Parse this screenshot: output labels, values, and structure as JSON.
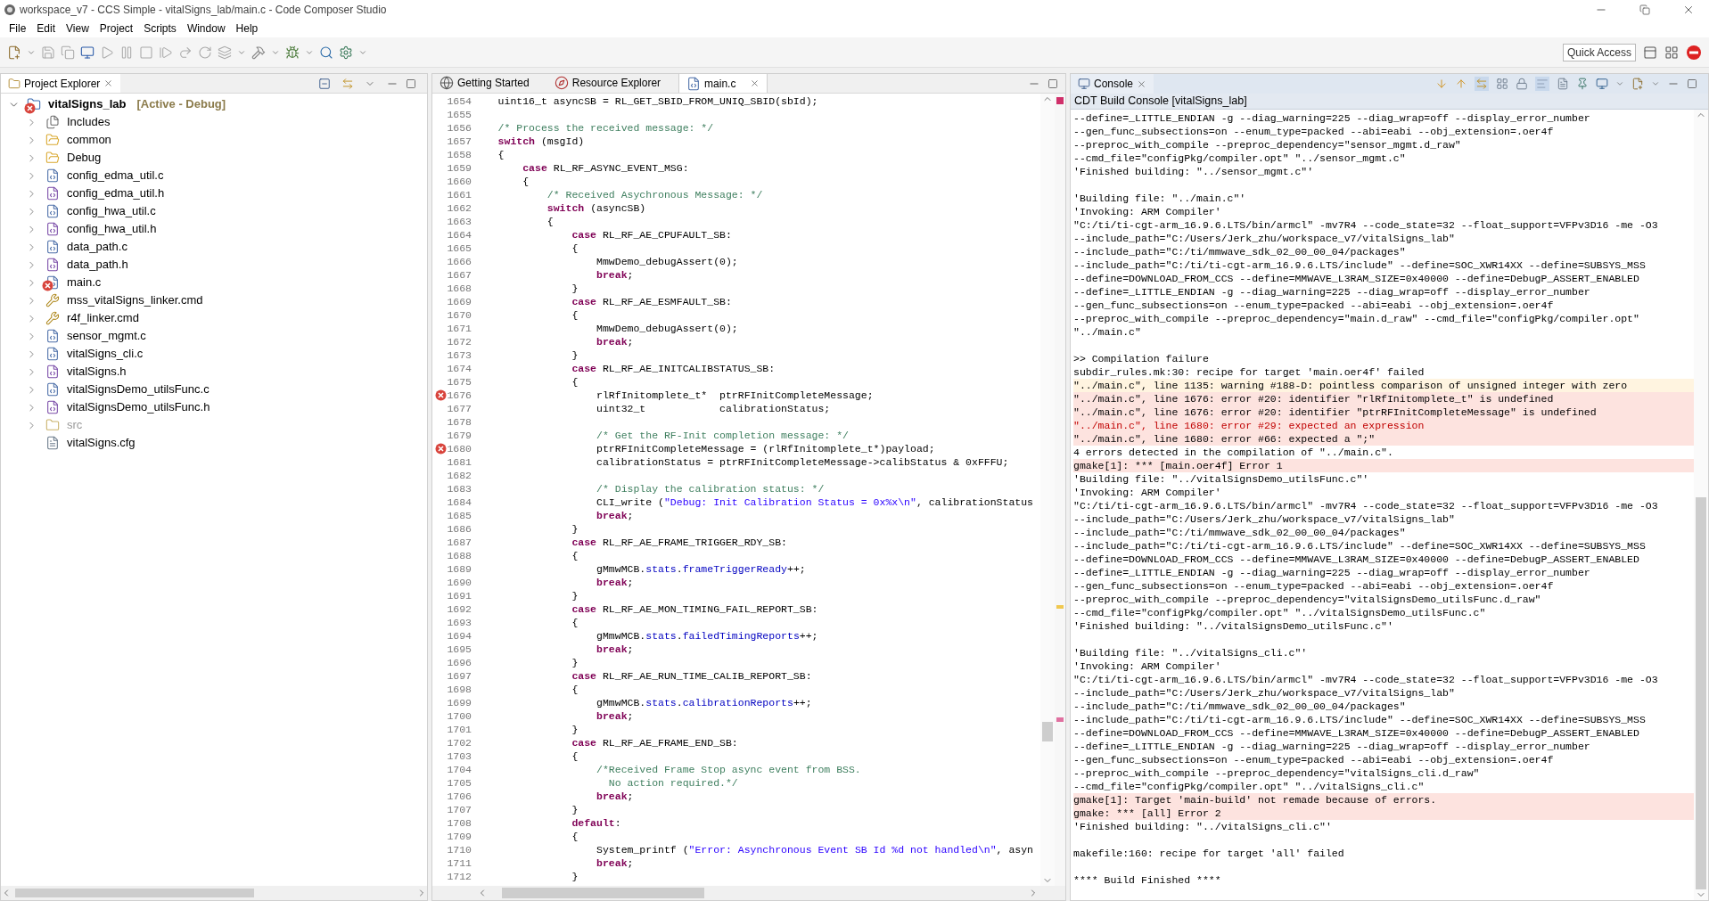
{
  "window": {
    "title": "workspace_v7 - CCS Simple - vitalSigns_lab/main.c - Code Composer Studio"
  },
  "menu": [
    "File",
    "Edit",
    "View",
    "Project",
    "Scripts",
    "Window",
    "Help"
  ],
  "quick_access": "Quick Access",
  "project_explorer": {
    "title": "Project Explorer",
    "root": {
      "name": "vitalSigns_lab",
      "annotation": "[Active - Debug]",
      "expanded": true,
      "error": true,
      "children": [
        {
          "name": "Includes",
          "kind": "includes",
          "expandable": true,
          "error": false,
          "greyed": false
        },
        {
          "name": "common",
          "kind": "folder",
          "expandable": true,
          "error": false,
          "greyed": false
        },
        {
          "name": "Debug",
          "kind": "folder",
          "expandable": true,
          "error": false,
          "greyed": false
        },
        {
          "name": "config_edma_util.c",
          "kind": "c-file",
          "expandable": true,
          "error": false,
          "greyed": false
        },
        {
          "name": "config_edma_util.h",
          "kind": "h-file",
          "expandable": true,
          "error": false,
          "greyed": false
        },
        {
          "name": "config_hwa_util.c",
          "kind": "c-file",
          "expandable": true,
          "error": false,
          "greyed": false
        },
        {
          "name": "config_hwa_util.h",
          "kind": "h-file",
          "expandable": true,
          "error": false,
          "greyed": false
        },
        {
          "name": "data_path.c",
          "kind": "c-file",
          "expandable": true,
          "error": false,
          "greyed": false
        },
        {
          "name": "data_path.h",
          "kind": "h-file",
          "expandable": true,
          "error": false,
          "greyed": false
        },
        {
          "name": "main.c",
          "kind": "c-file",
          "expandable": true,
          "error": true,
          "greyed": false
        },
        {
          "name": "mss_vitalSigns_linker.cmd",
          "kind": "linker",
          "expandable": true,
          "error": false,
          "greyed": false
        },
        {
          "name": "r4f_linker.cmd",
          "kind": "linker",
          "expandable": true,
          "error": false,
          "greyed": false
        },
        {
          "name": "sensor_mgmt.c",
          "kind": "c-file",
          "expandable": true,
          "error": false,
          "greyed": false
        },
        {
          "name": "vitalSigns_cli.c",
          "kind": "c-file",
          "expandable": true,
          "error": false,
          "greyed": false
        },
        {
          "name": "vitalSigns.h",
          "kind": "h-file",
          "expandable": true,
          "error": false,
          "greyed": false
        },
        {
          "name": "vitalSignsDemo_utilsFunc.c",
          "kind": "c-file",
          "expandable": true,
          "error": false,
          "greyed": false
        },
        {
          "name": "vitalSignsDemo_utilsFunc.h",
          "kind": "h-file",
          "expandable": true,
          "error": false,
          "greyed": false
        },
        {
          "name": "src",
          "kind": "source-folder",
          "expandable": true,
          "error": false,
          "greyed": true
        },
        {
          "name": "vitalSigns.cfg",
          "kind": "config",
          "expandable": false,
          "error": false,
          "greyed": false
        }
      ]
    }
  },
  "editor": {
    "tabs": [
      {
        "label": "Getting Started",
        "kind": "globe",
        "selected": false,
        "closable": false
      },
      {
        "label": "Resource Explorer",
        "kind": "compass",
        "selected": false,
        "closable": false
      },
      {
        "label": "main.c",
        "kind": "c-file",
        "selected": true,
        "closable": true
      }
    ],
    "lines": [
      {
        "number": "1654",
        "error": false,
        "segments": [
          {
            "kind": "plain",
            "text": "    uint16_t asyncSB = RL_GET_SBID_FROM_UNIQ_SBID(sbId);"
          }
        ]
      },
      {
        "number": "1655",
        "error": false
      },
      {
        "number": "1656",
        "error": false,
        "segments": [
          {
            "kind": "comment",
            "text": "    /* Process the received message: */"
          }
        ]
      },
      {
        "number": "1657",
        "error": false,
        "segments": [
          {
            "kind": "keyword",
            "text": "    switch"
          },
          {
            "kind": "plain",
            "text": " (msgId)"
          }
        ]
      },
      {
        "number": "1658",
        "error": false,
        "segments": [
          {
            "kind": "plain",
            "text": "    {"
          }
        ]
      },
      {
        "number": "1659",
        "error": false,
        "segments": [
          {
            "kind": "keyword",
            "text": "        case"
          },
          {
            "kind": "plain",
            "text": " RL_RF_ASYNC_EVENT_MSG:"
          }
        ]
      },
      {
        "number": "1660",
        "error": false,
        "segments": [
          {
            "kind": "plain",
            "text": "        {"
          }
        ]
      },
      {
        "number": "1661",
        "error": false,
        "segments": [
          {
            "kind": "comment",
            "text": "            /* Received Asychronous Message: */"
          }
        ]
      },
      {
        "number": "1662",
        "error": false,
        "segments": [
          {
            "kind": "keyword",
            "text": "            switch"
          },
          {
            "kind": "plain",
            "text": " (asyncSB)"
          }
        ]
      },
      {
        "number": "1663",
        "error": false,
        "segments": [
          {
            "kind": "plain",
            "text": "            {"
          }
        ]
      },
      {
        "number": "1664",
        "error": false,
        "segments": [
          {
            "kind": "keyword",
            "text": "                case"
          },
          {
            "kind": "plain",
            "text": " RL_RF_AE_CPUFAULT_SB:"
          }
        ]
      },
      {
        "number": "1665",
        "error": false,
        "segments": [
          {
            "kind": "plain",
            "text": "                {"
          }
        ]
      },
      {
        "number": "1666",
        "error": false,
        "segments": [
          {
            "kind": "plain",
            "text": "                    MmwDemo_debugAssert(0);"
          }
        ]
      },
      {
        "number": "1667",
        "error": false,
        "segments": [
          {
            "kind": "keyword",
            "text": "                    break"
          },
          {
            "kind": "plain",
            "text": ";"
          }
        ]
      },
      {
        "number": "1668",
        "error": false,
        "segments": [
          {
            "kind": "plain",
            "text": "                }"
          }
        ]
      },
      {
        "number": "1669",
        "error": false,
        "segments": [
          {
            "kind": "keyword",
            "text": "                case"
          },
          {
            "kind": "plain",
            "text": " RL_RF_AE_ESMFAULT_SB:"
          }
        ]
      },
      {
        "number": "1670",
        "error": false,
        "segments": [
          {
            "kind": "plain",
            "text": "                {"
          }
        ]
      },
      {
        "number": "1671",
        "error": false,
        "segments": [
          {
            "kind": "plain",
            "text": "                    MmwDemo_debugAssert(0);"
          }
        ]
      },
      {
        "number": "1672",
        "error": false,
        "segments": [
          {
            "kind": "keyword",
            "text": "                    break"
          },
          {
            "kind": "plain",
            "text": ";"
          }
        ]
      },
      {
        "number": "1673",
        "error": false,
        "segments": [
          {
            "kind": "plain",
            "text": "                }"
          }
        ]
      },
      {
        "number": "1674",
        "error": false,
        "segments": [
          {
            "kind": "keyword",
            "text": "                case"
          },
          {
            "kind": "plain",
            "text": " RL_RF_AE_INITCALIBSTATUS_SB:"
          }
        ]
      },
      {
        "number": "1675",
        "error": false,
        "segments": [
          {
            "kind": "plain",
            "text": "                {"
          }
        ]
      },
      {
        "number": "1676",
        "error": true,
        "segments": [
          {
            "kind": "plain",
            "text": "                    rlRfInitomplete_t*  ptrRFInitCompleteMessage;"
          }
        ]
      },
      {
        "number": "1677",
        "error": false,
        "segments": [
          {
            "kind": "plain",
            "text": "                    uint32_t            calibrationStatus;"
          }
        ]
      },
      {
        "number": "1678",
        "error": false
      },
      {
        "number": "1679",
        "error": false,
        "segments": [
          {
            "kind": "comment",
            "text": "                    /* Get the RF-Init completion message: */"
          }
        ]
      },
      {
        "number": "1680",
        "error": true,
        "segments": [
          {
            "kind": "plain",
            "text": "                    ptrRFInitCompleteMessage = (rlRfInitomplete_t*)payload;"
          }
        ]
      },
      {
        "number": "1681",
        "error": false,
        "segments": [
          {
            "kind": "plain",
            "text": "                    calibrationStatus = ptrRFInitCompleteMessage->calibStatus & 0xFFFU;"
          }
        ]
      },
      {
        "number": "1682",
        "error": false
      },
      {
        "number": "1683",
        "error": false,
        "segments": [
          {
            "kind": "comment",
            "text": "                    /* Display the calibration status: */"
          }
        ]
      },
      {
        "number": "1684",
        "error": false,
        "segments": [
          {
            "kind": "plain",
            "text": "                    CLI_write ("
          },
          {
            "kind": "string",
            "text": "\"Debug: Init Calibration Status = 0x%x\\n\""
          },
          {
            "kind": "plain",
            "text": ", calibrationStatus"
          }
        ]
      },
      {
        "number": "1685",
        "error": false,
        "segments": [
          {
            "kind": "keyword",
            "text": "                    break"
          },
          {
            "kind": "plain",
            "text": ";"
          }
        ]
      },
      {
        "number": "1686",
        "error": false,
        "segments": [
          {
            "kind": "plain",
            "text": "                }"
          }
        ]
      },
      {
        "number": "1687",
        "error": false,
        "segments": [
          {
            "kind": "keyword",
            "text": "                case"
          },
          {
            "kind": "plain",
            "text": " RL_RF_AE_FRAME_TRIGGER_RDY_SB:"
          }
        ]
      },
      {
        "number": "1688",
        "error": false,
        "segments": [
          {
            "kind": "plain",
            "text": "                {"
          }
        ]
      },
      {
        "number": "1689",
        "error": false,
        "segments": [
          {
            "kind": "plain",
            "text": "                    gMmwMCB."
          },
          {
            "kind": "field",
            "text": "stats"
          },
          {
            "kind": "plain",
            "text": "."
          },
          {
            "kind": "field",
            "text": "frameTriggerReady"
          },
          {
            "kind": "plain",
            "text": "++;"
          }
        ]
      },
      {
        "number": "1690",
        "error": false,
        "segments": [
          {
            "kind": "keyword",
            "text": "                    break"
          },
          {
            "kind": "plain",
            "text": ";"
          }
        ]
      },
      {
        "number": "1691",
        "error": false,
        "segments": [
          {
            "kind": "plain",
            "text": "                }"
          }
        ]
      },
      {
        "number": "1692",
        "error": false,
        "segments": [
          {
            "kind": "keyword",
            "text": "                case"
          },
          {
            "kind": "plain",
            "text": " RL_RF_AE_MON_TIMING_FAIL_REPORT_SB:"
          }
        ]
      },
      {
        "number": "1693",
        "error": false,
        "segments": [
          {
            "kind": "plain",
            "text": "                {"
          }
        ]
      },
      {
        "number": "1694",
        "error": false,
        "segments": [
          {
            "kind": "plain",
            "text": "                    gMmwMCB."
          },
          {
            "kind": "field",
            "text": "stats"
          },
          {
            "kind": "plain",
            "text": "."
          },
          {
            "kind": "field",
            "text": "failedTimingReports"
          },
          {
            "kind": "plain",
            "text": "++;"
          }
        ]
      },
      {
        "number": "1695",
        "error": false,
        "segments": [
          {
            "kind": "keyword",
            "text": "                    break"
          },
          {
            "kind": "plain",
            "text": ";"
          }
        ]
      },
      {
        "number": "1696",
        "error": false,
        "segments": [
          {
            "kind": "plain",
            "text": "                }"
          }
        ]
      },
      {
        "number": "1697",
        "error": false,
        "segments": [
          {
            "kind": "keyword",
            "text": "                case"
          },
          {
            "kind": "plain",
            "text": " RL_RF_AE_RUN_TIME_CALIB_REPORT_SB:"
          }
        ]
      },
      {
        "number": "1698",
        "error": false,
        "segments": [
          {
            "kind": "plain",
            "text": "                {"
          }
        ]
      },
      {
        "number": "1699",
        "error": false,
        "segments": [
          {
            "kind": "plain",
            "text": "                    gMmwMCB."
          },
          {
            "kind": "field",
            "text": "stats"
          },
          {
            "kind": "plain",
            "text": "."
          },
          {
            "kind": "field",
            "text": "calibrationReports"
          },
          {
            "kind": "plain",
            "text": "++;"
          }
        ]
      },
      {
        "number": "1700",
        "error": false,
        "segments": [
          {
            "kind": "keyword",
            "text": "                    break"
          },
          {
            "kind": "plain",
            "text": ";"
          }
        ]
      },
      {
        "number": "1701",
        "error": false,
        "segments": [
          {
            "kind": "plain",
            "text": "                }"
          }
        ]
      },
      {
        "number": "1702",
        "error": false,
        "segments": [
          {
            "kind": "keyword",
            "text": "                case"
          },
          {
            "kind": "plain",
            "text": " RL_RF_AE_FRAME_END_SB:"
          }
        ]
      },
      {
        "number": "1703",
        "error": false,
        "segments": [
          {
            "kind": "plain",
            "text": "                {"
          }
        ]
      },
      {
        "number": "1704",
        "error": false,
        "segments": [
          {
            "kind": "comment",
            "text": "                    /*Received Frame Stop async event from BSS."
          }
        ]
      },
      {
        "number": "1705",
        "error": false,
        "segments": [
          {
            "kind": "comment",
            "text": "                      No action required.*/"
          }
        ]
      },
      {
        "number": "1706",
        "error": false,
        "segments": [
          {
            "kind": "keyword",
            "text": "                    break"
          },
          {
            "kind": "plain",
            "text": ";"
          }
        ]
      },
      {
        "number": "1707",
        "error": false,
        "segments": [
          {
            "kind": "plain",
            "text": "                }"
          }
        ]
      },
      {
        "number": "1708",
        "error": false,
        "segments": [
          {
            "kind": "keyword",
            "text": "                default"
          },
          {
            "kind": "plain",
            "text": ":"
          }
        ]
      },
      {
        "number": "1709",
        "error": false,
        "segments": [
          {
            "kind": "plain",
            "text": "                {"
          }
        ]
      },
      {
        "number": "1710",
        "error": false,
        "segments": [
          {
            "kind": "plain",
            "text": "                    System_printf ("
          },
          {
            "kind": "string",
            "text": "\"Error: Asynchronous Event SB Id %d not handled\\n\""
          },
          {
            "kind": "plain",
            "text": ", asyn"
          }
        ]
      },
      {
        "number": "1711",
        "error": false,
        "segments": [
          {
            "kind": "keyword",
            "text": "                    break"
          },
          {
            "kind": "plain",
            "text": ";"
          }
        ]
      },
      {
        "number": "1712",
        "error": false,
        "segments": [
          {
            "kind": "plain",
            "text": "                }"
          }
        ]
      }
    ]
  },
  "console": {
    "title": "Console",
    "subtitle": "CDT Build Console [vitalSigns_lab]",
    "lines": [
      {
        "kind": "normal",
        "text": "--define=_LITTLE_ENDIAN -g --diag_warning=225 --diag_wrap=off --display_error_number"
      },
      {
        "kind": "normal",
        "text": "--gen_func_subsections=on --enum_type=packed --abi=eabi --obj_extension=.oer4f"
      },
      {
        "kind": "normal",
        "text": "--preproc_with_compile --preproc_dependency=\"sensor_mgmt.d_raw\""
      },
      {
        "kind": "normal",
        "text": "--cmd_file=\"configPkg/compiler.opt\" \"../sensor_mgmt.c\""
      },
      {
        "kind": "normal",
        "text": "'Finished building: \"../sensor_mgmt.c\"'"
      },
      {
        "kind": "blank"
      },
      {
        "kind": "normal",
        "text": "'Building file: \"../main.c\"'"
      },
      {
        "kind": "normal",
        "text": "'Invoking: ARM Compiler'"
      },
      {
        "kind": "normal",
        "text": "\"C:/ti/ti-cgt-arm_16.9.6.LTS/bin/armcl\" -mv7R4 --code_state=32 --float_support=VFPv3D16 -me -O3"
      },
      {
        "kind": "normal",
        "text": "--include_path=\"C:/Users/Jerk_zhu/workspace_v7/vitalSigns_lab\""
      },
      {
        "kind": "normal",
        "text": "--include_path=\"C:/ti/mmwave_sdk_02_00_00_04/packages\""
      },
      {
        "kind": "normal",
        "text": "--include_path=\"C:/ti/ti-cgt-arm_16.9.6.LTS/include\" --define=SOC_XWR14XX --define=SUBSYS_MSS"
      },
      {
        "kind": "normal",
        "text": "--define=DOWNLOAD_FROM_CCS --define=MMWAVE_L3RAM_SIZE=0x40000 --define=DebugP_ASSERT_ENABLED"
      },
      {
        "kind": "normal",
        "text": "--define=_LITTLE_ENDIAN -g --diag_warning=225 --diag_wrap=off --display_error_number"
      },
      {
        "kind": "normal",
        "text": "--gen_func_subsections=on --enum_type=packed --abi=eabi --obj_extension=.oer4f"
      },
      {
        "kind": "normal",
        "text": "--preproc_with_compile --preproc_dependency=\"main.d_raw\" --cmd_file=\"configPkg/compiler.opt\""
      },
      {
        "kind": "normal",
        "text": "\"../main.c\""
      },
      {
        "kind": "blank"
      },
      {
        "kind": "normal",
        "text": ">> Compilation failure"
      },
      {
        "kind": "normal",
        "text": "subdir_rules.mk:30: recipe for target 'main.oer4f' failed"
      },
      {
        "kind": "warning",
        "text": "\"../main.c\", line 1135: warning #188-D: pointless comparison of unsigned integer with zero"
      },
      {
        "kind": "error",
        "text": "\"../main.c\", line 1676: error #20: identifier \"rlRfInitomplete_t\" is undefined"
      },
      {
        "kind": "error",
        "text": "\"../main.c\", line 1676: error #20: identifier \"ptrRFInitCompleteMessage\" is undefined"
      },
      {
        "kind": "error-selected",
        "text": "\"../main.c\", line 1680: error #29: expected an expression"
      },
      {
        "kind": "error",
        "text": "\"../main.c\", line 1680: error #66: expected a \";\""
      },
      {
        "kind": "normal",
        "text": "4 errors detected in the compilation of \"../main.c\"."
      },
      {
        "kind": "error",
        "text": "gmake[1]: *** [main.oer4f] Error 1"
      },
      {
        "kind": "normal",
        "text": "'Building file: \"../vitalSignsDemo_utilsFunc.c\"'"
      },
      {
        "kind": "normal",
        "text": "'Invoking: ARM Compiler'"
      },
      {
        "kind": "normal",
        "text": "\"C:/ti/ti-cgt-arm_16.9.6.LTS/bin/armcl\" -mv7R4 --code_state=32 --float_support=VFPv3D16 -me -O3"
      },
      {
        "kind": "normal",
        "text": "--include_path=\"C:/Users/Jerk_zhu/workspace_v7/vitalSigns_lab\""
      },
      {
        "kind": "normal",
        "text": "--include_path=\"C:/ti/mmwave_sdk_02_00_00_04/packages\""
      },
      {
        "kind": "normal",
        "text": "--include_path=\"C:/ti/ti-cgt-arm_16.9.6.LTS/include\" --define=SOC_XWR14XX --define=SUBSYS_MSS"
      },
      {
        "kind": "normal",
        "text": "--define=DOWNLOAD_FROM_CCS --define=MMWAVE_L3RAM_SIZE=0x40000 --define=DebugP_ASSERT_ENABLED"
      },
      {
        "kind": "normal",
        "text": "--define=_LITTLE_ENDIAN -g --diag_warning=225 --diag_wrap=off --display_error_number"
      },
      {
        "kind": "normal",
        "text": "--gen_func_subsections=on --enum_type=packed --abi=eabi --obj_extension=.oer4f"
      },
      {
        "kind": "normal",
        "text": "--preproc_with_compile --preproc_dependency=\"vitalSignsDemo_utilsFunc.d_raw\""
      },
      {
        "kind": "normal",
        "text": "--cmd_file=\"configPkg/compiler.opt\" \"../vitalSignsDemo_utilsFunc.c\""
      },
      {
        "kind": "normal",
        "text": "'Finished building: \"../vitalSignsDemo_utilsFunc.c\"'"
      },
      {
        "kind": "blank"
      },
      {
        "kind": "normal",
        "text": "'Building file: \"../vitalSigns_cli.c\"'"
      },
      {
        "kind": "normal",
        "text": "'Invoking: ARM Compiler'"
      },
      {
        "kind": "normal",
        "text": "\"C:/ti/ti-cgt-arm_16.9.6.LTS/bin/armcl\" -mv7R4 --code_state=32 --float_support=VFPv3D16 -me -O3"
      },
      {
        "kind": "normal",
        "text": "--include_path=\"C:/Users/Jerk_zhu/workspace_v7/vitalSigns_lab\""
      },
      {
        "kind": "normal",
        "text": "--include_path=\"C:/ti/mmwave_sdk_02_00_00_04/packages\""
      },
      {
        "kind": "normal",
        "text": "--include_path=\"C:/ti/ti-cgt-arm_16.9.6.LTS/include\" --define=SOC_XWR14XX --define=SUBSYS_MSS"
      },
      {
        "kind": "normal",
        "text": "--define=DOWNLOAD_FROM_CCS --define=MMWAVE_L3RAM_SIZE=0x40000 --define=DebugP_ASSERT_ENABLED"
      },
      {
        "kind": "normal",
        "text": "--define=_LITTLE_ENDIAN -g --diag_warning=225 --diag_wrap=off --display_error_number"
      },
      {
        "kind": "normal",
        "text": "--gen_func_subsections=on --enum_type=packed --abi=eabi --obj_extension=.oer4f"
      },
      {
        "kind": "normal",
        "text": "--preproc_with_compile --preproc_dependency=\"vitalSigns_cli.d_raw\""
      },
      {
        "kind": "normal",
        "text": "--cmd_file=\"configPkg/compiler.opt\" \"../vitalSigns_cli.c\""
      },
      {
        "kind": "error",
        "text": "gmake[1]: Target 'main-build' not remade because of errors."
      },
      {
        "kind": "error",
        "text": "gmake: *** [all] Error 2"
      },
      {
        "kind": "normal",
        "text": "'Finished building: \"../vitalSigns_cli.c\"'"
      },
      {
        "kind": "blank"
      },
      {
        "kind": "normal",
        "text": "makefile:160: recipe for target 'all' failed"
      },
      {
        "kind": "blank"
      },
      {
        "kind": "normal",
        "text": "**** Build Finished ****"
      }
    ]
  }
}
